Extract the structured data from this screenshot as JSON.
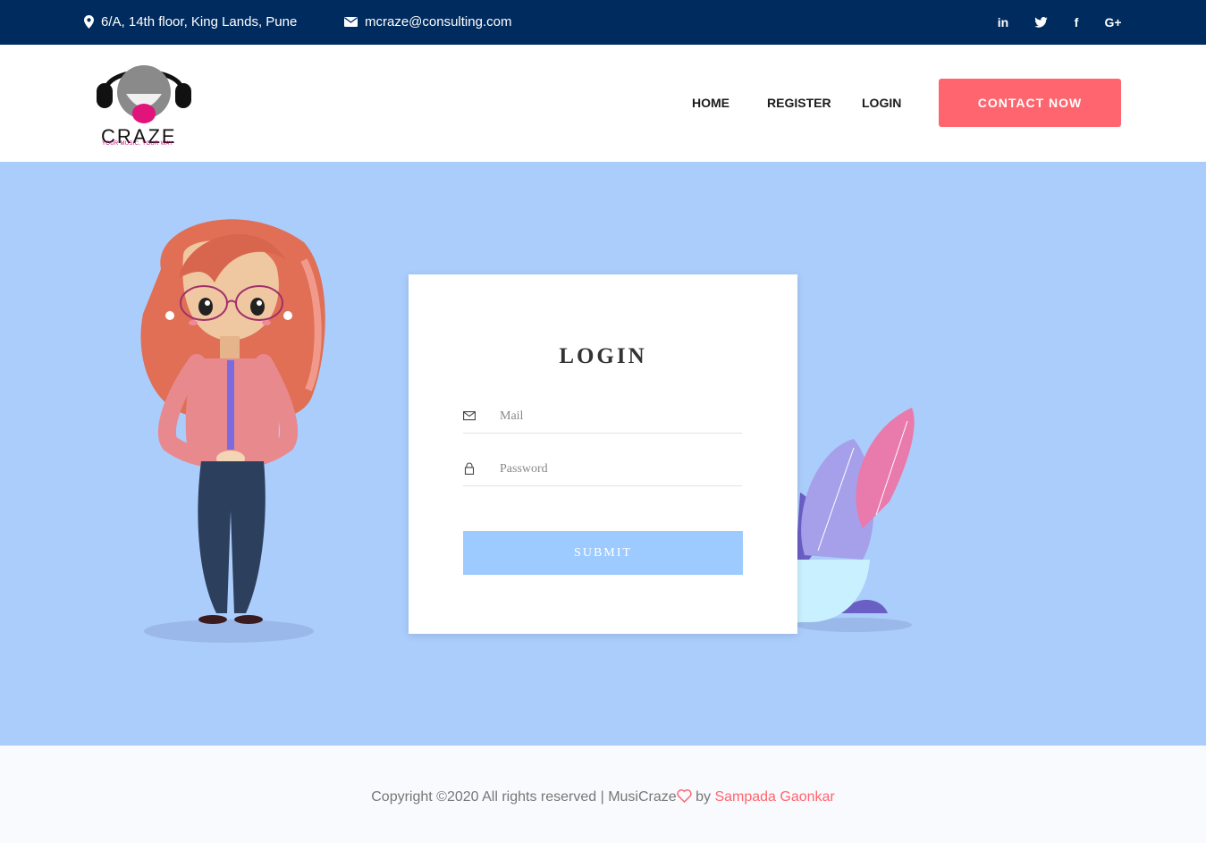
{
  "topbar": {
    "address": "6/A, 14th floor, King Lands, Pune",
    "address_icon": "map-pin-icon",
    "email": "mcraze@consulting.com",
    "email_icon": "envelope-icon",
    "social": [
      {
        "label": "in",
        "icon": "linkedin-icon"
      },
      {
        "label": "t",
        "icon": "twitter-icon"
      },
      {
        "label": "f",
        "icon": "facebook-icon"
      },
      {
        "label": "G+",
        "icon": "google-plus-icon"
      }
    ]
  },
  "header": {
    "logo_word": "CRAZE",
    "logo_tagline": "YOUR MUSIC, YOUR WAY",
    "nav": [
      {
        "label": "HOME"
      },
      {
        "label": "REGISTER"
      },
      {
        "label": "LOGIN"
      }
    ],
    "contact_button": "CONTACT NOW"
  },
  "login": {
    "title": "LOGIN",
    "mail_placeholder": "Mail",
    "password_placeholder": "Password",
    "submit_label": "SUBMIT"
  },
  "footer": {
    "copyright": "Copyright ©2020 All rights reserved | MusiCraze",
    "by": " by ",
    "author": "Sampada Gaonkar"
  },
  "colors": {
    "topbar": "#002b5e",
    "accent": "#ff656e",
    "hero_bg": "#abcdfb",
    "submit_bg": "#9ecbff"
  }
}
